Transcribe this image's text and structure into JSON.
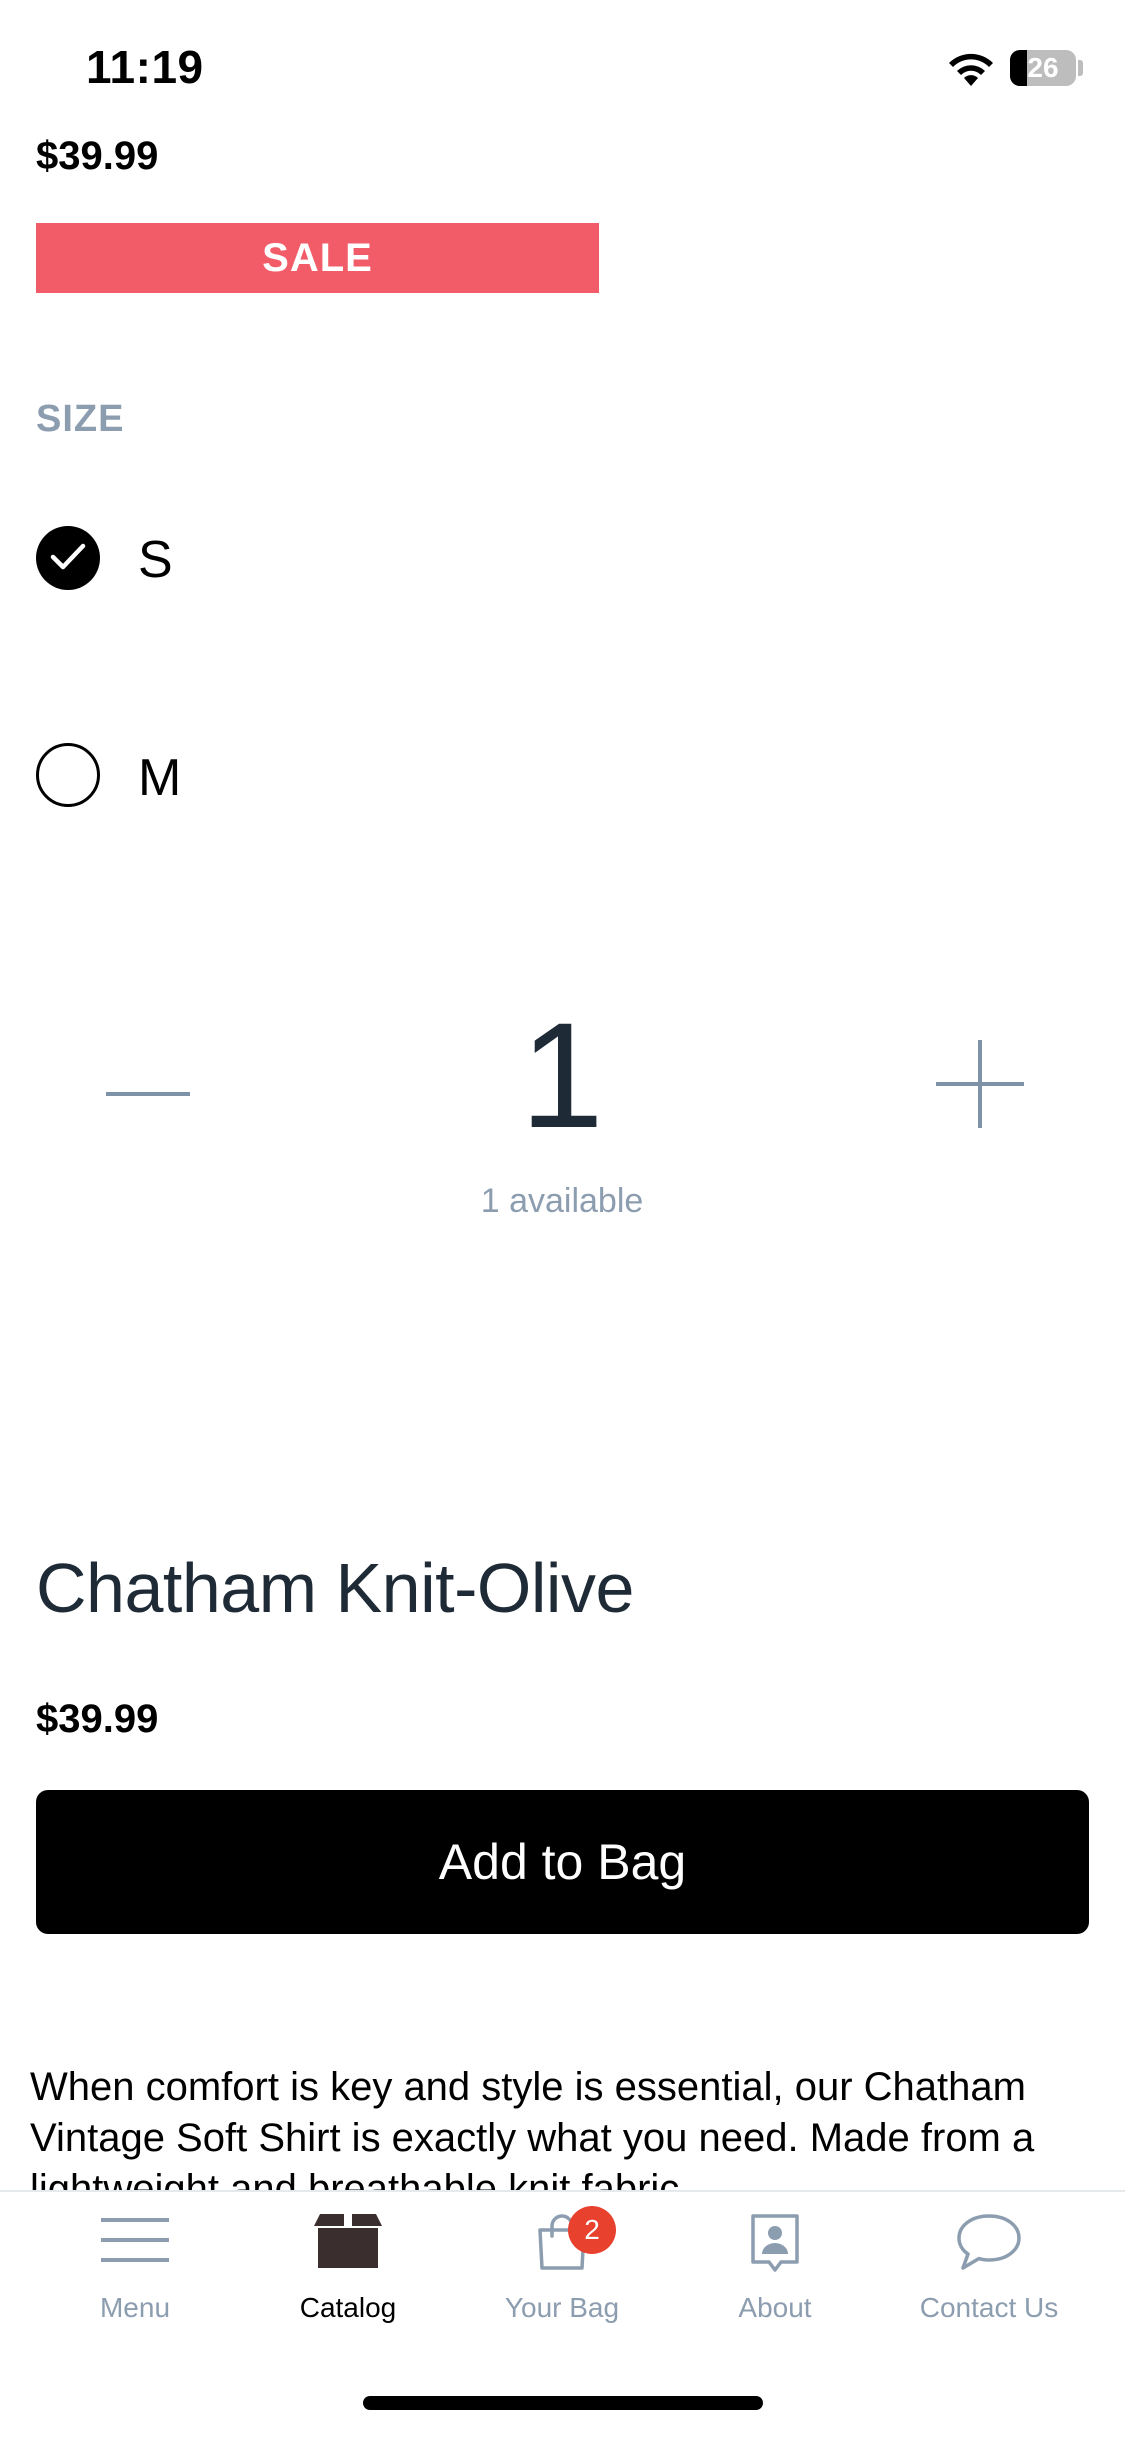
{
  "status_bar": {
    "time": "11:19",
    "battery_level": "26"
  },
  "product": {
    "price_top": "$39.99",
    "sale_badge": "SALE",
    "size_label": "SIZE",
    "sizes": [
      {
        "label": "S",
        "selected": true
      },
      {
        "label": "M",
        "selected": false
      }
    ],
    "quantity": "1",
    "available_text": "1 available",
    "name": "Chatham Knit-Olive",
    "price_bottom": "$39.99",
    "add_to_bag_label": "Add to Bag",
    "description": "When comfort is key and style is essential, our Chatham Vintage Soft Shirt is exactly what you need. Made from a lightweight and breathable knit fabric"
  },
  "tab_bar": {
    "tabs": [
      {
        "label": "Menu",
        "icon": "menu-icon",
        "active": false
      },
      {
        "label": "Catalog",
        "icon": "box-icon",
        "active": true
      },
      {
        "label": "Your Bag",
        "icon": "bag-icon",
        "active": false,
        "badge": "2"
      },
      {
        "label": "About",
        "icon": "person-icon",
        "active": false
      },
      {
        "label": "Contact Us",
        "icon": "chat-bubble-icon",
        "active": false
      }
    ]
  },
  "colors": {
    "sale": "#f25c69",
    "muted": "#8c9db0",
    "heading": "#1e2a36",
    "badge": "#e8412e"
  }
}
